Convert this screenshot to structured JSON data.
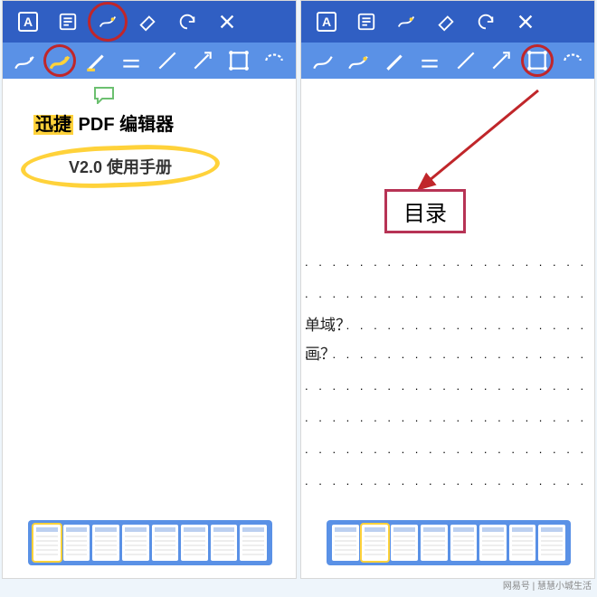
{
  "watermark": "网易号 | 慧慧小城生活",
  "topbar": {
    "textTool": "A",
    "icons": [
      "text-tool",
      "note-tool",
      "freehand-tool",
      "eraser-tool",
      "undo-icon",
      "close-icon"
    ]
  },
  "toolbar": {
    "icons": [
      "pen1",
      "freehand-hl",
      "highlighter",
      "underline",
      "line",
      "arrow",
      "rect-select",
      "circle-select"
    ]
  },
  "left": {
    "line1_hl": "迅捷",
    "line1_rest": " PDF 编辑器",
    "line2": "V2.0 使用手册"
  },
  "right": {
    "toc": "目录",
    "partial1": "单域？",
    "partial2": "画？"
  },
  "dots": ". . . . . . . . . . . . . . . . . . . . . . . . . . . . . . . . . . . . . .",
  "thumbs": 8
}
